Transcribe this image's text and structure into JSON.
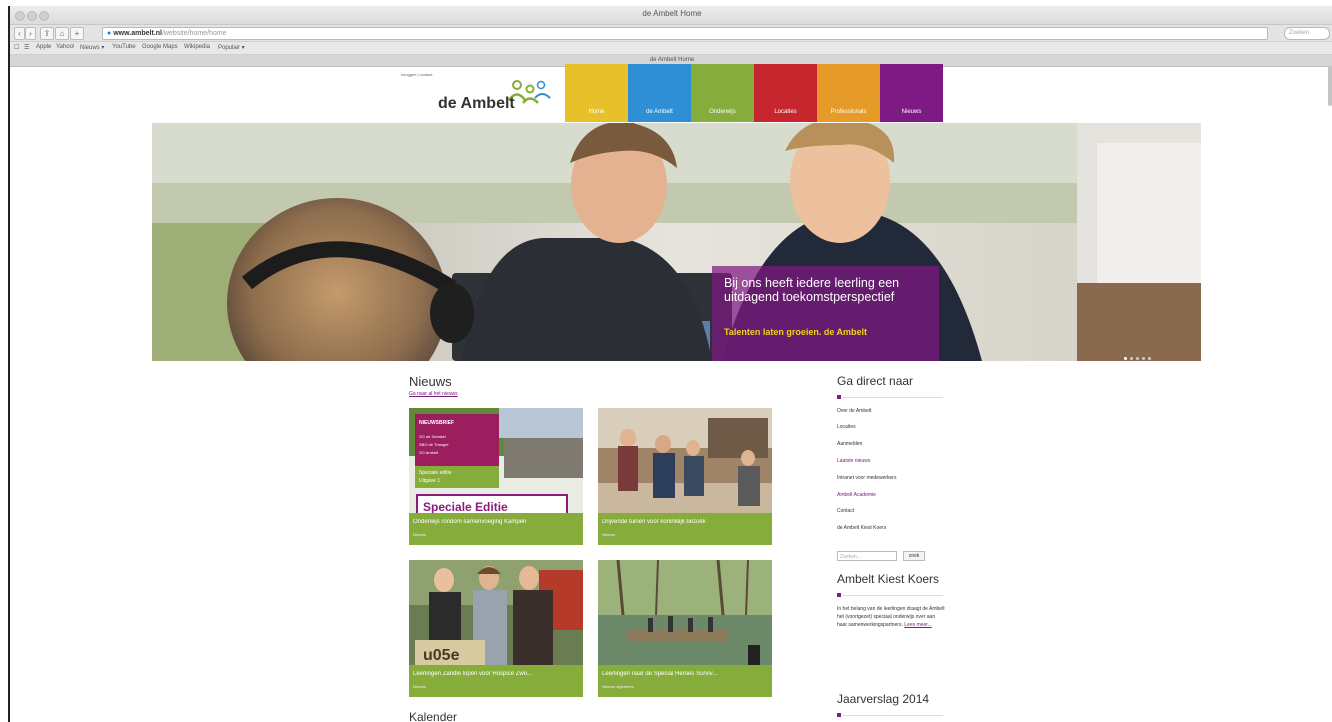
{
  "browser": {
    "window_title": "de Ambelt Home",
    "url_host": "www.ambelt.nl",
    "url_path": "/website/home/home",
    "search_placeholder": "Zoeken",
    "tab_title": "de Ambelt Home",
    "bookmarks": [
      "Apple",
      "Yahoo!",
      "Nieuws ▾",
      "YouTube",
      "Google Maps",
      "Wikipedia",
      "Populair ▾"
    ]
  },
  "site": {
    "top_links": "Inloggen | contact",
    "logo_text": "de Ambelt",
    "nav": [
      {
        "label": "Home",
        "color": "#e8c12a"
      },
      {
        "label": "de Ambelt",
        "color": "#2f8fd6"
      },
      {
        "label": "Onderwijs",
        "color": "#86ad3b"
      },
      {
        "label": "Locaties",
        "color": "#c8262f"
      },
      {
        "label": "Professionals",
        "color": "#e69a27"
      },
      {
        "label": "Nieuws",
        "color": "#7d1a83"
      }
    ]
  },
  "hero": {
    "headline": "Bij ons heeft iedere leerling een uitdagend toekomstperspectief",
    "tagline": "Talenten laten groeien. de Ambelt"
  },
  "news": {
    "title": "Nieuws",
    "all_link": "Ga naar al het nieuws",
    "cards": [
      {
        "title": "Onderwijs rondom samenvoeging Kampen",
        "category": "Nieuws"
      },
      {
        "title": "Drijvende tuinen voor koninklijk bezoek",
        "category": "Nieuws"
      },
      {
        "title": "Leerlingen Zandle lopen voor Hospice Zwo...",
        "category": "Nieuws"
      },
      {
        "title": "Leerlingen naar de Special Heroes Surviv...",
        "category": "Nieuws algemeen"
      }
    ],
    "newsletter": {
      "heading": "NIEUWSBRIEF",
      "lines": [
        "SO de Schakel",
        "SBO de Triangel",
        "SO Ambelt"
      ],
      "edition": "Speciale editie",
      "issue": "Uitgave 1",
      "banner": "Speciale Editie"
    }
  },
  "kalender_title": "Kalender",
  "sidebar": {
    "direct_title": "Ga direct naar",
    "links": [
      "Over de Ambelt",
      "Locaties",
      "Aanmelden",
      "Laatste nieuws",
      "Intranet voor medewerkers",
      "Ambelt Academie",
      "Contact",
      "de Ambelt Kiest Koers"
    ],
    "search_placeholder": "Zoeken...",
    "search_button": "zoek",
    "koers_title": "Ambelt Kiest Koers",
    "koers_text": "In het belang van de leerlingen draagt de Ambelt het (voortgezet) speciaal onderwijs over aan haar samenwerkingspartners.",
    "koers_link": "Lees meer...",
    "jaarverslag_title": "Jaarverslag 2014"
  }
}
